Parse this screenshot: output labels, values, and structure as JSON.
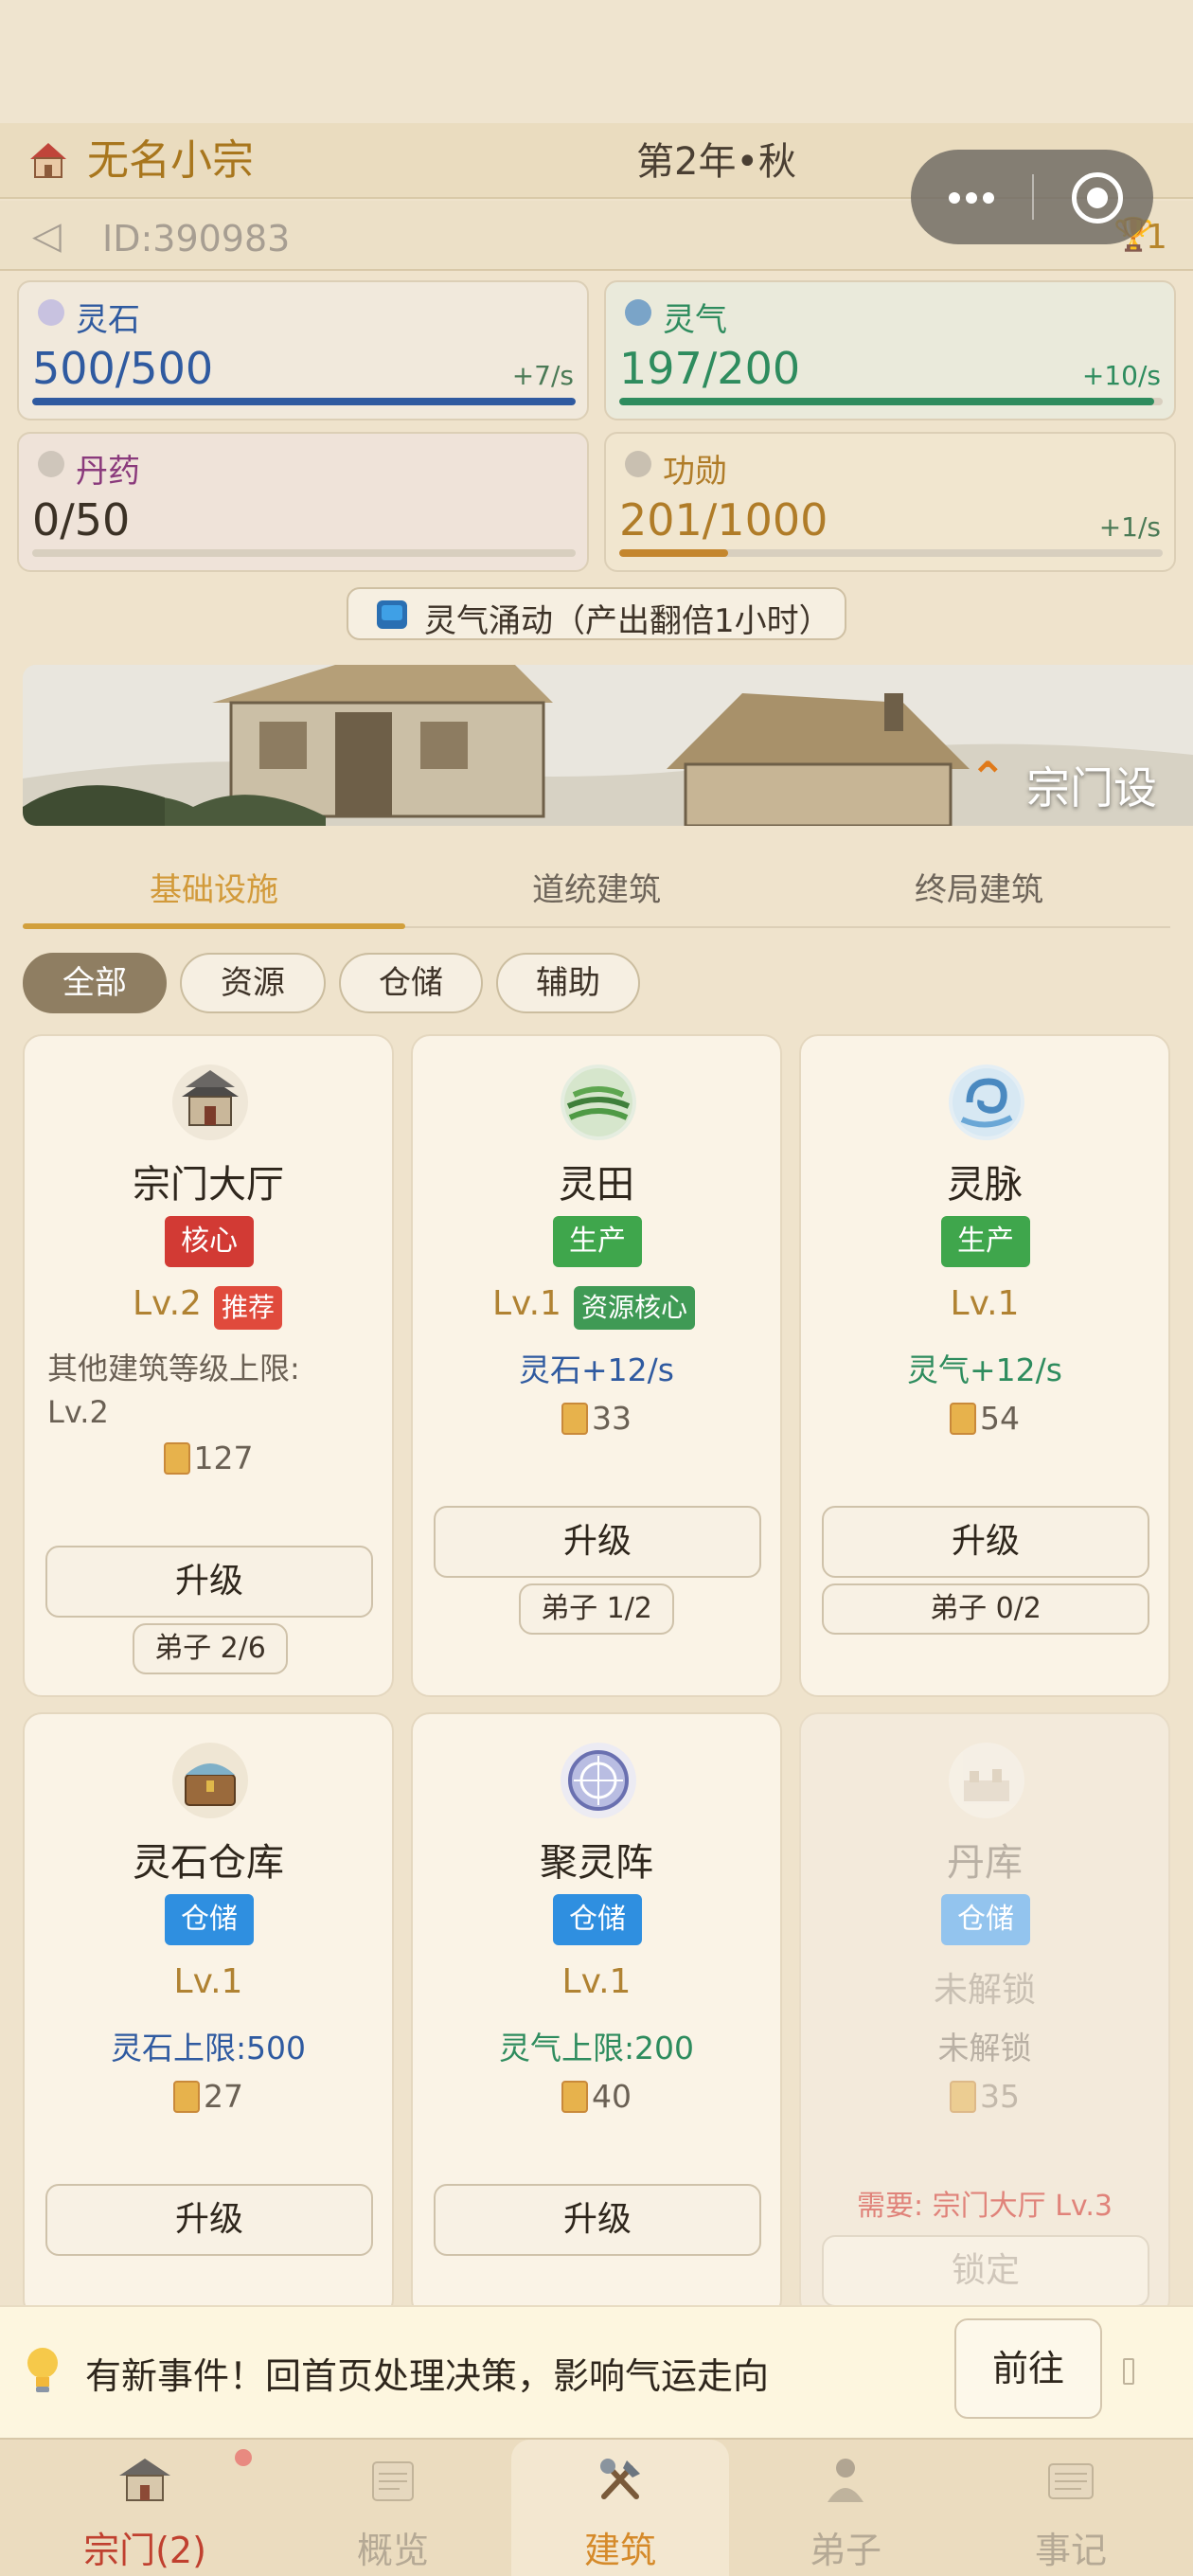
{
  "header": {
    "sect_name": "无名小宗",
    "season": "第2年•秋",
    "id_text": "ID:390983",
    "trophy_count": "1"
  },
  "resources": [
    {
      "name": "灵石",
      "value": "500/500",
      "rate": "+7/s",
      "fill": 1.0,
      "color": "#2f5aa0",
      "text_color": "#2f5aa0"
    },
    {
      "name": "灵气",
      "value": "197/200",
      "rate": "+10/s",
      "fill": 0.985,
      "color": "#2e8c5e",
      "text_color": "#2e8c5e"
    },
    {
      "name": "丹药",
      "value": "0/50",
      "rate": "",
      "fill": 0.0,
      "color": "#8a3a7c",
      "text_color": "#3b3125"
    },
    {
      "name": "功勋",
      "value": "201/1000",
      "rate": "+1/s",
      "fill": 0.201,
      "color": "#c4862e",
      "text_color": "#b07c28"
    }
  ],
  "boost": {
    "label": "灵气涌动（产出翻倍1小时）",
    "icon": "tv-icon"
  },
  "banner": {
    "title": "宗门设施"
  },
  "tabs": [
    {
      "label": "基础设施",
      "active": true
    },
    {
      "label": "道统建筑",
      "active": false
    },
    {
      "label": "终局建筑",
      "active": false
    }
  ],
  "filters": [
    {
      "label": "全部",
      "active": true
    },
    {
      "label": "资源",
      "active": false
    },
    {
      "label": "仓储",
      "active": false
    },
    {
      "label": "辅助",
      "active": false
    }
  ],
  "buildings": [
    {
      "name": "宗门大厅",
      "tag": "核心",
      "tag_color": "#d23a34",
      "level": "Lv.2",
      "sub_tag": "推荐",
      "sub_color": "#e04a3c",
      "effect_line1": "其他建筑等级上限:",
      "effect_line2": "Lv.2",
      "cost": "127",
      "button": "升级",
      "disciples": "弟子 2/6"
    },
    {
      "name": "灵田",
      "tag": "生产",
      "tag_color": "#3fa64c",
      "level": "Lv.1",
      "sub_tag": "资源核心",
      "sub_color": "#3f9a55",
      "effect": "灵石+12/s",
      "effect_color": "#2f5aa0",
      "cost": "33",
      "button": "升级",
      "disciples": "弟子 1/2"
    },
    {
      "name": "灵脉",
      "tag": "生产",
      "tag_color": "#3fa64c",
      "level": "Lv.1",
      "effect": "灵气+12/s",
      "effect_color": "#2e8c5e",
      "cost": "54",
      "button": "升级",
      "disciples": "弟子 0/2"
    },
    {
      "name": "灵石仓库",
      "tag": "仓储",
      "tag_color": "#2f8fe0",
      "level": "Lv.1",
      "effect": "灵石上限:500",
      "effect_color": "#2f5aa0",
      "cost": "27",
      "button": "升级"
    },
    {
      "name": "聚灵阵",
      "tag": "仓储",
      "tag_color": "#2f8fe0",
      "level": "Lv.1",
      "effect": "灵气上限:200",
      "effect_color": "#2e8c5e",
      "cost": "40",
      "button": "升级"
    },
    {
      "name": "丹库",
      "tag": "仓储",
      "tag_color": "#93c4ee",
      "level": "未解锁",
      "effect": "未解锁",
      "effect_color": "#b9b0a4",
      "cost": "35",
      "requirement": "需要: 宗门大厅 Lv.3",
      "button": "锁定"
    }
  ],
  "notify": {
    "text": "有新事件！回首页处理决策，影响气运走向",
    "button": "前往"
  },
  "nav": [
    {
      "label": "宗门(2)",
      "icon": "sect-hall-icon",
      "active": false,
      "color": "#c0402f"
    },
    {
      "label": "概览",
      "icon": "scroll-overview-icon",
      "active": false,
      "color": "#b5a995"
    },
    {
      "label": "建筑",
      "icon": "tools-icon",
      "active": true,
      "color": "#d58a2a"
    },
    {
      "label": "弟子",
      "icon": "disciple-icon",
      "active": false,
      "color": "#b5a995"
    },
    {
      "label": "事记",
      "icon": "records-icon",
      "active": false,
      "color": "#b5a995"
    }
  ]
}
